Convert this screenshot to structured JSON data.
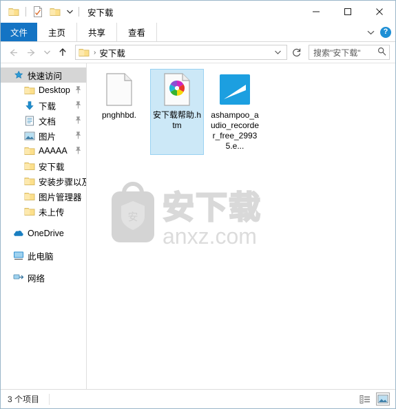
{
  "window": {
    "title": "安下载",
    "quick_access_toolbar": [
      {
        "name": "folder-properties-icon",
        "label": "属性"
      },
      {
        "name": "new-folder-icon",
        "label": "新建文件夹"
      },
      {
        "name": "customize-qat-caret-icon",
        "label": "自定义快速访问工具栏"
      }
    ],
    "controls": {
      "minimize": "最小化",
      "maximize": "最大化",
      "close": "关闭"
    }
  },
  "ribbon": {
    "tabs": [
      {
        "label": "文件",
        "active": true
      },
      {
        "label": "主页",
        "active": false
      },
      {
        "label": "共享",
        "active": false
      },
      {
        "label": "查看",
        "active": false
      }
    ],
    "collapse_label": "展开功能区",
    "help_label": "?"
  },
  "addressbar": {
    "back_label": "后退",
    "forward_label": "前进",
    "history_label": "最近浏览的位置",
    "up_label": "上移到",
    "breadcrumb": {
      "folder_icon": "folder-icon",
      "separator": "›",
      "path": "安下载"
    },
    "refresh_label": "刷新",
    "search": {
      "placeholder": "搜索\"安下载\"",
      "value": ""
    }
  },
  "sidebar": {
    "items": [
      {
        "label": "快速访问",
        "icon": "star-pin-icon",
        "level": "root",
        "selected": true,
        "pinned": false
      },
      {
        "label": "Desktop",
        "icon": "folder-icon",
        "level": "child",
        "selected": false,
        "pinned": true
      },
      {
        "label": "下载",
        "icon": "download-arrow-icon",
        "level": "child",
        "selected": false,
        "pinned": true
      },
      {
        "label": "文档",
        "icon": "documents-icon",
        "level": "child",
        "selected": false,
        "pinned": true
      },
      {
        "label": "图片",
        "icon": "pictures-icon",
        "level": "child",
        "selected": false,
        "pinned": true
      },
      {
        "label": "AAAAA",
        "icon": "folder-icon",
        "level": "child",
        "selected": false,
        "pinned": true
      },
      {
        "label": "安下载",
        "icon": "folder-icon",
        "level": "child",
        "selected": false,
        "pinned": false
      },
      {
        "label": "安装步骤以及",
        "icon": "folder-icon",
        "level": "child",
        "selected": false,
        "pinned": false
      },
      {
        "label": "图片管理器",
        "icon": "folder-icon",
        "level": "child",
        "selected": false,
        "pinned": false
      },
      {
        "label": "未上传",
        "icon": "folder-icon",
        "level": "child",
        "selected": false,
        "pinned": false
      }
    ],
    "roots": [
      {
        "label": "OneDrive",
        "icon": "onedrive-cloud-icon"
      },
      {
        "label": "此电脑",
        "icon": "this-pc-icon"
      },
      {
        "label": "网络",
        "icon": "network-icon"
      }
    ]
  },
  "files": [
    {
      "label": "pnghhbd.",
      "icon": "blank-document-icon",
      "selected": false
    },
    {
      "label": "安下载帮助.htm",
      "icon": "html-pinwheel-icon",
      "selected": true
    },
    {
      "label": "ashampoo_audio_recorder_free_29935.e...",
      "icon": "ashampoo-exe-icon",
      "selected": false
    }
  ],
  "watermark": {
    "logo_char": "安",
    "title": "安下载",
    "site": "anxz.com"
  },
  "statusbar": {
    "item_count": "3 个项目",
    "views": [
      {
        "name": "details-view-button",
        "label": "详细信息",
        "active": false
      },
      {
        "name": "large-icons-view-button",
        "label": "大图标",
        "active": true
      }
    ]
  },
  "colors": {
    "accent_blue": "#1474c4",
    "selection_blue": "#cce8f7",
    "folder_yellow": "#fcdf8b",
    "ashampoo_blue": "#1c9fe0",
    "watermark_gray": "#d7d7d7"
  }
}
